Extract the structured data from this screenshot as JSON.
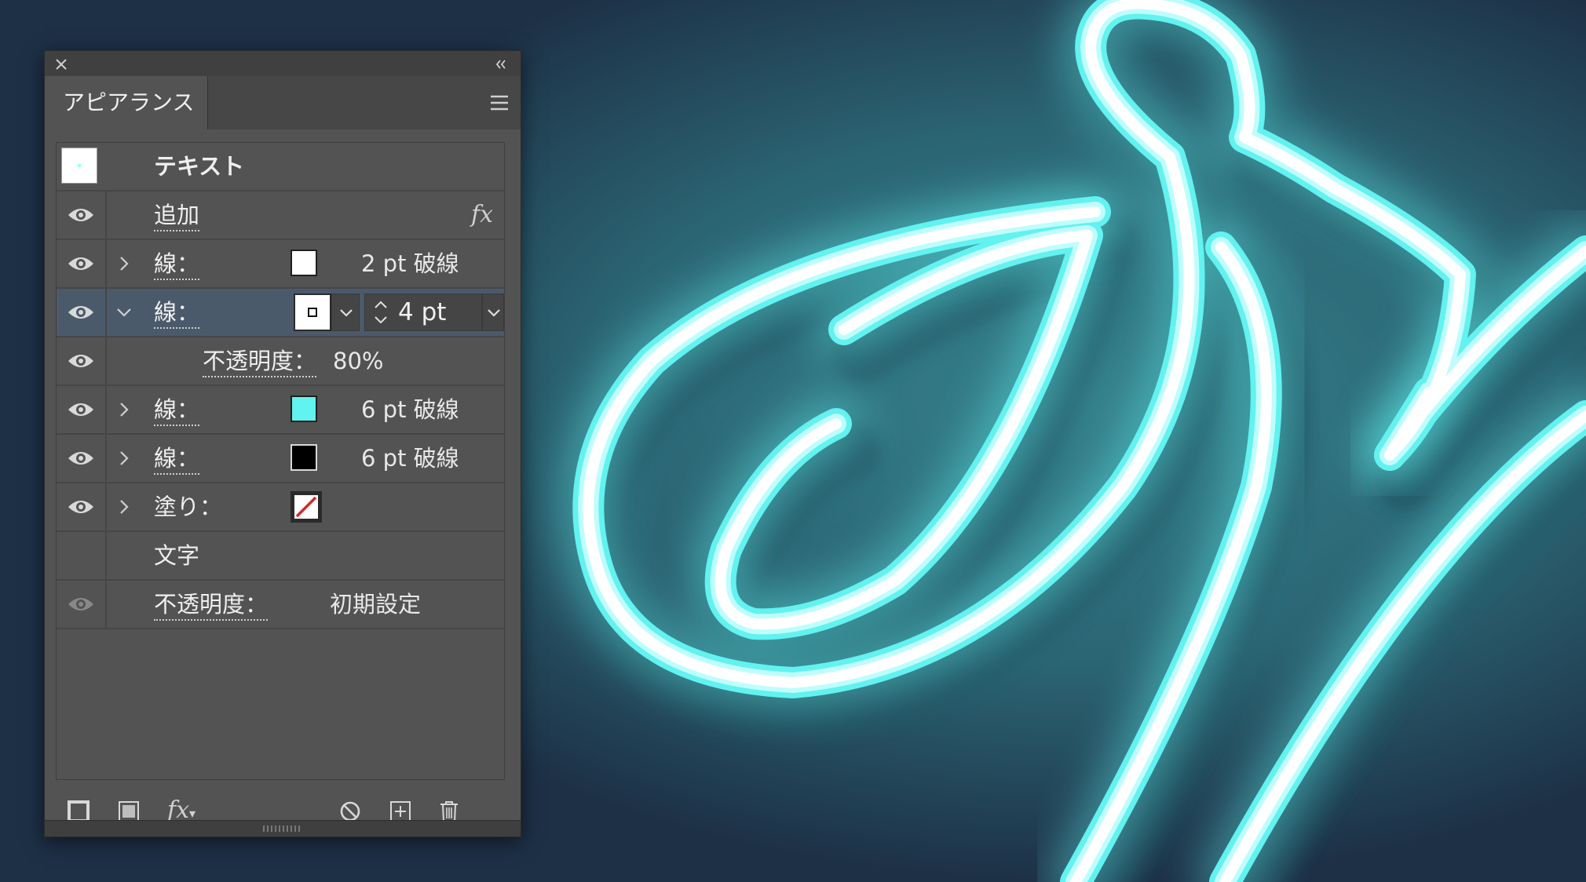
{
  "panel": {
    "tab_label": "アピアランス",
    "target": {
      "label": "テキスト"
    },
    "rows": [
      {
        "kind": "add",
        "label": "追加",
        "fx": "fx"
      },
      {
        "kind": "stroke",
        "label": "線：",
        "swatch_color": "#ffffff",
        "value": "2 pt 破線"
      },
      {
        "kind": "stroke-selected",
        "label": "線：",
        "stroke_weight": "4 pt"
      },
      {
        "kind": "opacity",
        "label": "不透明度：",
        "value": "80%"
      },
      {
        "kind": "stroke",
        "label": "線：",
        "swatch_color": "#62f2f0",
        "value": "6 pt 破線"
      },
      {
        "kind": "stroke",
        "label": "線：",
        "swatch_color": "#000000",
        "value": "6 pt 破線"
      },
      {
        "kind": "fill",
        "label": "塗り：",
        "swatch": "none-swatch"
      },
      {
        "kind": "characters",
        "label": "文字"
      },
      {
        "kind": "opacity-dim",
        "label": "不透明度：",
        "value": "初期設定"
      }
    ],
    "bottom_fx": "fx"
  },
  "icons": [
    "close-icon",
    "collapse-icon",
    "menu-icon",
    "eye-icon",
    "chevron-right-icon",
    "chevron-down-icon",
    "add-stroke-icon",
    "add-fill-icon",
    "fx-icon",
    "clear-appearance-icon",
    "duplicate-item-icon",
    "trash-icon"
  ],
  "colors": {
    "neon": "#62f2f0",
    "background": "#1d3046",
    "panel": "#535353",
    "selection": "#4b5a6b"
  }
}
